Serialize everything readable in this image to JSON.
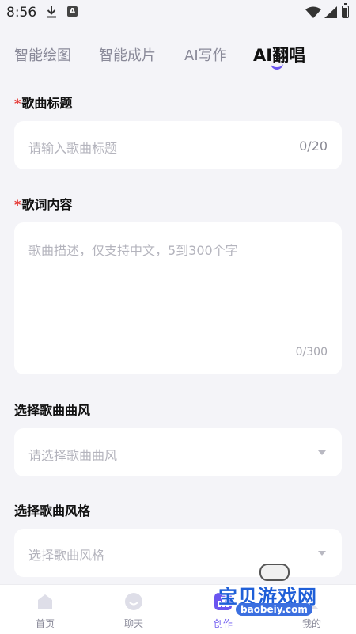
{
  "status_bar": {
    "time": "8:56",
    "notification_icons": [
      "download-icon",
      "android-app-icon"
    ],
    "right_icons": [
      "wifi-icon",
      "signal-icon",
      "battery-icon"
    ]
  },
  "tabs": [
    {
      "label": "智能绘图",
      "active": false
    },
    {
      "label": "智能成片",
      "active": false
    },
    {
      "label": "AI写作",
      "active": false
    },
    {
      "label": "AI翻唱",
      "active": true
    }
  ],
  "form": {
    "required_mark": "*",
    "title_field": {
      "label": "歌曲标题",
      "placeholder": "请输入歌曲标题",
      "counter": "0/20"
    },
    "lyrics_field": {
      "label": "歌词内容",
      "placeholder": "歌曲描述，仅支持中文，5到300个字",
      "counter": "0/300"
    },
    "genre_field": {
      "label": "选择歌曲曲风",
      "placeholder": "请选择歌曲曲风"
    },
    "style_field": {
      "label": "选择歌曲风格",
      "placeholder": "选择歌曲风格"
    }
  },
  "bottom_nav": [
    {
      "label": "首页",
      "icon": "home-icon",
      "active": false
    },
    {
      "label": "聊天",
      "icon": "chat-icon",
      "active": false
    },
    {
      "label": "创作",
      "icon": "create-icon",
      "active": true
    },
    {
      "label": "我的",
      "icon": "profile-icon",
      "active": false
    }
  ],
  "watermark": {
    "text": "宝贝游戏网",
    "url": "baobeiy.com"
  },
  "colors": {
    "accent": "#6a55f0",
    "required": "#e53935",
    "background": "#f4f4f8",
    "card": "#ffffff",
    "placeholder": "#b4b4bd"
  }
}
